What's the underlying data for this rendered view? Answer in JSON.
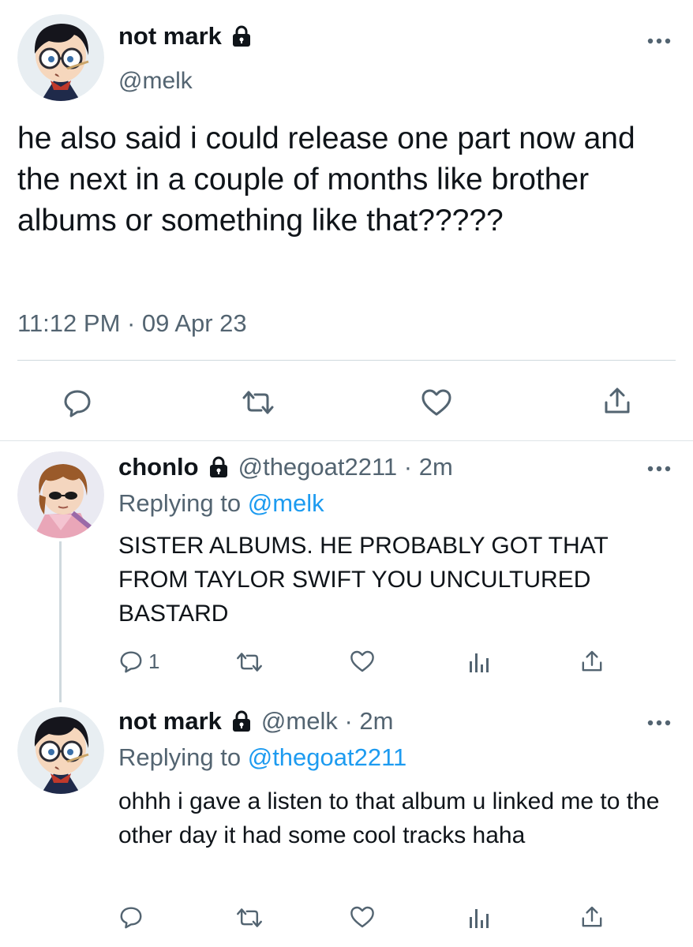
{
  "main_tweet": {
    "display_name": "not mark",
    "handle": "@melk",
    "text": "he also said i could release one part now and the next in a couple of months like brother albums or something like that?????",
    "timestamp": "11:12 PM · 09 Apr 23",
    "icons": [
      "lock-icon",
      "more-icon",
      "reply-icon",
      "retweet-icon",
      "like-icon",
      "share-icon"
    ]
  },
  "replies": [
    {
      "display_name": "chonlo",
      "handle_time": "@thegoat2211 · 2m",
      "replying_prefix": "Replying to",
      "replying_to": "@melk",
      "text": "SISTER ALBUMS. HE PROBABLY GOT THAT FROM TAYLOR SWIFT YOU UNCULTURED BASTARD",
      "reply_count": "1",
      "icons": [
        "lock-icon",
        "more-icon",
        "reply-icon",
        "retweet-icon",
        "like-icon",
        "analytics-icon",
        "share-icon"
      ]
    },
    {
      "display_name": "not mark",
      "handle_time": "@melk · 2m",
      "replying_prefix": "Replying to",
      "replying_to": "@thegoat2211",
      "text": "ohhh i gave a listen to that album u linked me to the other day it had some cool tracks haha",
      "icons": [
        "lock-icon",
        "more-icon",
        "reply-icon",
        "retweet-icon",
        "like-icon",
        "analytics-icon",
        "share-icon"
      ]
    }
  ],
  "colors": {
    "text": "#0f1419",
    "secondary": "#536471",
    "link": "#1d9bf0",
    "divider": "#cfd9de"
  }
}
